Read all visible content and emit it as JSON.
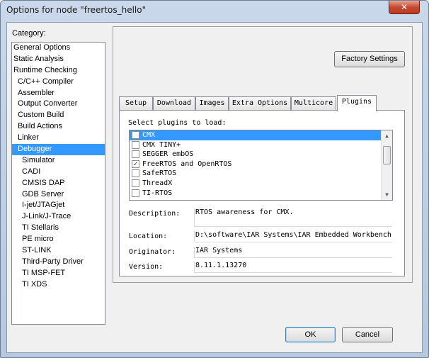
{
  "window": {
    "title": "Options for node \"freertos_hello\"",
    "close_glyph": "✕"
  },
  "category": {
    "label": "Category:",
    "items": [
      {
        "label": "General Options",
        "level": 0
      },
      {
        "label": "Static Analysis",
        "level": 0
      },
      {
        "label": "Runtime Checking",
        "level": 0
      },
      {
        "label": "C/C++ Compiler",
        "level": 1
      },
      {
        "label": "Assembler",
        "level": 1
      },
      {
        "label": "Output Converter",
        "level": 1
      },
      {
        "label": "Custom Build",
        "level": 1
      },
      {
        "label": "Build Actions",
        "level": 1
      },
      {
        "label": "Linker",
        "level": 1
      },
      {
        "label": "Debugger",
        "level": 1,
        "selected": true
      },
      {
        "label": "Simulator",
        "level": 2
      },
      {
        "label": "CADI",
        "level": 2
      },
      {
        "label": "CMSIS DAP",
        "level": 2
      },
      {
        "label": "GDB Server",
        "level": 2
      },
      {
        "label": "I-jet/JTAGjet",
        "level": 2
      },
      {
        "label": "J-Link/J-Trace",
        "level": 2
      },
      {
        "label": "TI Stellaris",
        "level": 2
      },
      {
        "label": "PE micro",
        "level": 2
      },
      {
        "label": "ST-LINK",
        "level": 2
      },
      {
        "label": "Third-Party Driver",
        "level": 2
      },
      {
        "label": "TI MSP-FET",
        "level": 2
      },
      {
        "label": "TI XDS",
        "level": 2
      }
    ]
  },
  "factory_settings_label": "Factory Settings",
  "tabs": [
    {
      "label": "Setup"
    },
    {
      "label": "Download"
    },
    {
      "label": "Images"
    },
    {
      "label": "Extra Options"
    },
    {
      "label": "Multicore"
    },
    {
      "label": "Plugins",
      "active": true
    }
  ],
  "plugins": {
    "select_label": "Select plugins to load:",
    "check_glyph": "✓",
    "items": [
      {
        "label": "CMX",
        "checked": false,
        "selected": true
      },
      {
        "label": "CMX TINY+",
        "checked": false
      },
      {
        "label": "SEGGER embOS",
        "checked": false
      },
      {
        "label": "FreeRTOS and OpenRTOS",
        "checked": true
      },
      {
        "label": "SafeRTOS",
        "checked": false
      },
      {
        "label": "ThreadX",
        "checked": false
      },
      {
        "label": "TI-RTOS",
        "checked": false
      }
    ],
    "details": {
      "description_label": "Description:",
      "description_value": "RTOS awareness for CMX.",
      "location_label": "Location:",
      "location_value": "D:\\software\\IAR Systems\\IAR Embedded Workbench",
      "originator_label": "Originator:",
      "originator_value": "IAR Systems",
      "version_label": "Version:",
      "version_value": "8.11.1.13270"
    }
  },
  "buttons": {
    "ok": "OK",
    "cancel": "Cancel"
  },
  "colors": {
    "selection": "#3399ff",
    "close_button": "#c74a30"
  }
}
